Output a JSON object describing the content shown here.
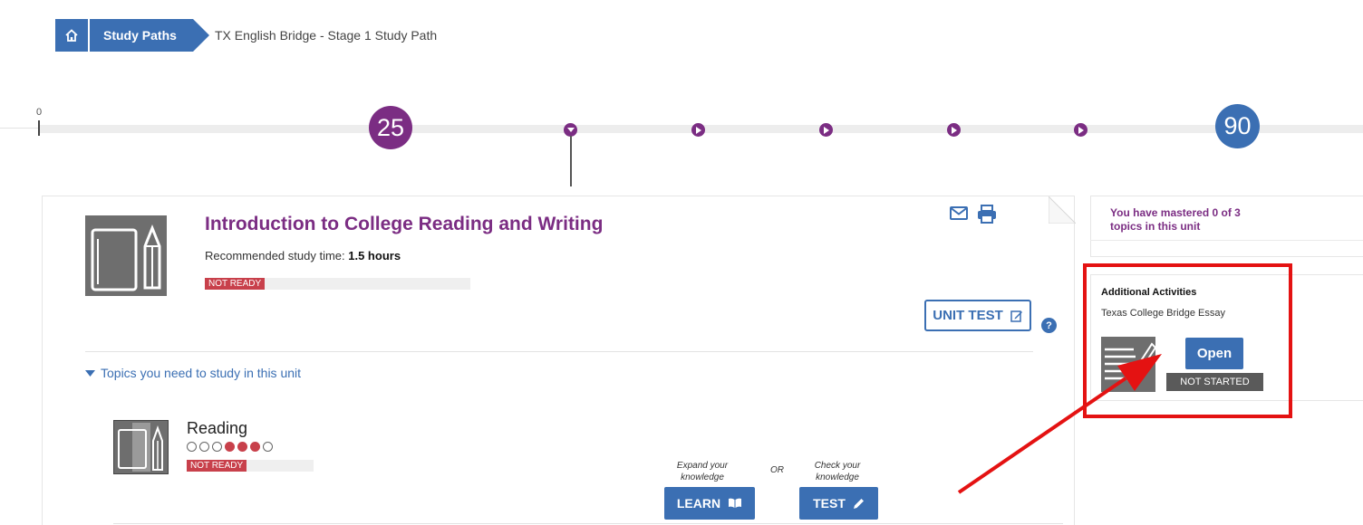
{
  "breadcrumb": {
    "home_icon": "home-icon",
    "study_paths": "Study Paths",
    "current": "TX English Bridge - Stage 1 Study Path"
  },
  "timeline": {
    "start_label": "0",
    "current_score": "25",
    "target_score": "90",
    "current_color": "#7b2d83",
    "target_color": "#3b6fb3"
  },
  "unit": {
    "title": "Introduction to College Reading and Writing",
    "rec_label": "Recommended study time:",
    "rec_value": "1.5 hours",
    "status": "NOT READY",
    "unit_test_label": "UNIT TEST",
    "help": "?",
    "topics_toggle": "Topics you need to study in this unit"
  },
  "topic": {
    "name": "Reading",
    "mastery": [
      false,
      false,
      false,
      true,
      true,
      true,
      false
    ],
    "status": "NOT READY",
    "expand_caption": [
      "Expand your",
      "knowledge"
    ],
    "or_label": "OR",
    "check_caption": [
      "Check your",
      "knowledge"
    ],
    "learn_label": "LEARN",
    "test_label": "TEST"
  },
  "right_panel": {
    "mastered_text": "You have mastered 0 of 3 topics in this unit",
    "additional_title": "Additional Activities",
    "activity_name": "Texas College Bridge Essay",
    "open_label": "Open",
    "activity_status": "NOT STARTED"
  },
  "colors": {
    "brand_blue": "#3b6fb3",
    "purple": "#7b2d83",
    "not_ready_red": "#c8404b",
    "highlight_red": "#e41212"
  }
}
